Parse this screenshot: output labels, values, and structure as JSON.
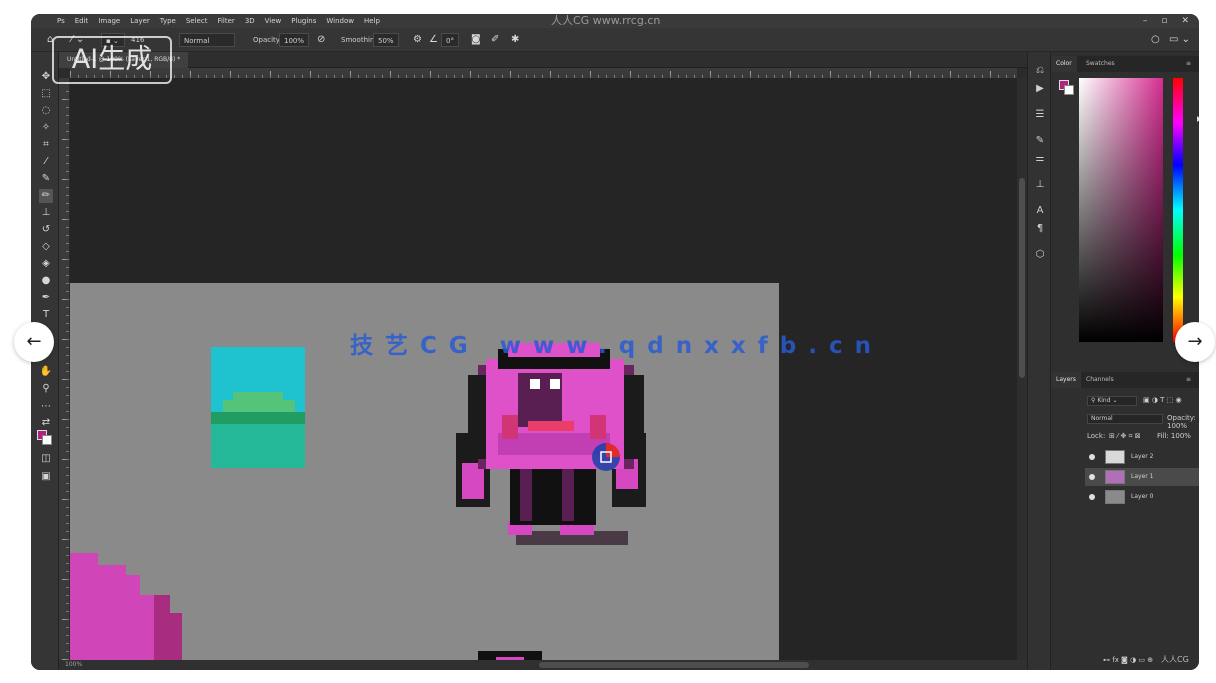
{
  "window": {
    "app_title": "人人CG www.rrcg.cn",
    "menu": [
      "Ps",
      "Edit",
      "Image",
      "Layer",
      "Type",
      "Select",
      "Filter",
      "3D",
      "View",
      "Plugins",
      "Window",
      "Help"
    ],
    "controls": [
      "–",
      "▫",
      "✕"
    ]
  },
  "options_bar": {
    "size_value": "416",
    "mode_label": "Normal",
    "opacity_label": "Opacity:",
    "opacity_value": "100%",
    "flow_label": "Smoothing:",
    "flow_value": "50%",
    "angle_value": "0°"
  },
  "document_tab": "Untitled-1 @ 100% (Layer 1, RGB/8) *",
  "status_bar": "100%",
  "panels": {
    "color_tabs": [
      "Color",
      "Swatches"
    ],
    "layers_tabs": [
      "Layers",
      "Channels"
    ],
    "kind_label": "Kind",
    "blend_mode": "Normal",
    "opacity_label": "Opacity: 100%",
    "lock_label": "Lock:",
    "fill_label": "Fill: 100%",
    "layers": [
      {
        "name": "Layer 2",
        "selected": false,
        "thumb": "#d9d9d9"
      },
      {
        "name": "Layer 1",
        "selected": true,
        "thumb": "#b06fb8"
      },
      {
        "name": "Layer 0",
        "selected": false,
        "thumb": "#8a8a8a"
      }
    ]
  },
  "colors": {
    "foreground": "#b0247e",
    "background": "#ffffff"
  },
  "overlays": {
    "ai_badge": "AI生成",
    "watermark": "技艺CG www.qdnxxfb.cn",
    "corner_logo": "人人CG"
  },
  "navigation": {
    "prev": "←",
    "next": "→"
  }
}
